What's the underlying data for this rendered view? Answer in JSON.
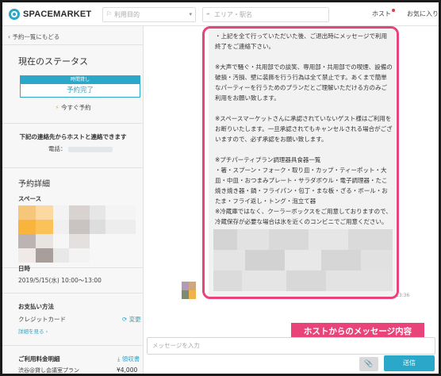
{
  "header": {
    "logo": "SPACEMARKET",
    "search_purpose_placeholder": "利用目的",
    "search_area_placeholder": "エリア・駅名",
    "host_link": "ホスト",
    "favorites_link": "お気に入り"
  },
  "sidebar": {
    "back_link": "予約一覧にもどる",
    "status_title": "現在のステータス",
    "badge_top": "時間貸し",
    "badge_main": "予約完了",
    "instant_booking": "今すぐ予約",
    "contact_note": "下記の連絡先からホストと連絡できます",
    "phone_label": "電話：",
    "details_title": "予約詳細",
    "space_label": "スペース",
    "date_label": "日時",
    "date_value": "2019/5/15(水) 10:00〜13:00",
    "payment_label": "お支払い方法",
    "payment_value": "クレジットカード",
    "change_link": "変更",
    "details_link": "詳細を見る",
    "fee_label": "ご利用料金明細",
    "receipt_link": "領収書",
    "plan_name": "渋谷@貸し会議室プラン",
    "plan_price": "¥4,000"
  },
  "chat": {
    "message_lines": [
      "・上記を全て行っていただいた後、ご退出時にメッセージで利用終了をご連絡下さい。",
      "",
      "※大声で騒ぐ・共用部での談笑、専用部・共用部での喫煙、設備の破損・汚損、壁に装飾を行う行為は全て禁止です。あくまで簡単なパーティーを行うためのプランだとご理解いただける方のみご利用をお願い致します。",
      "",
      "※スペースマーケットさんに承認されていないゲスト様はご利用をお断りいたします。一旦承認されてもキャンセルされる場合がございますので、必ず承認をお願い致します。",
      "",
      "※プチパーティプラン調理器具食器一覧",
      "・箸・スプーン・フォーク・取り皿・カップ・ティーポット・大皿・中皿・おつまみプレート・サラダボウル・電子調理器・たこ焼き焼き器・鍋・フライパン・包丁・まな板・ざる・ボール・おたま・フライ返し・トング・泡立て器",
      "※冷蔵庫ではなく、クーラーボックスをご用意しておりますので、冷蔵保存が必要な場合は氷を近くのコンビニでご用意ください。"
    ],
    "time": "13:36",
    "callout": "ホストからのメッセージ内容",
    "input_placeholder": "メッセージを入力",
    "send_label": "送信"
  },
  "colors": {
    "accent": "#2aa7c9",
    "highlight": "#e8447a"
  }
}
